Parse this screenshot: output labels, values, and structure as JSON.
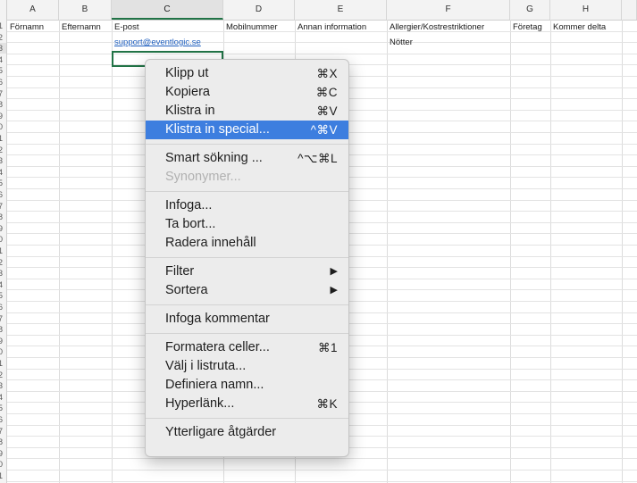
{
  "columns": [
    {
      "letter": "A",
      "header": "Förnamn"
    },
    {
      "letter": "B",
      "header": "Efternamn"
    },
    {
      "letter": "C",
      "header": "E-post"
    },
    {
      "letter": "D",
      "header": "Mobilnummer"
    },
    {
      "letter": "E",
      "header": "Annan information"
    },
    {
      "letter": "F",
      "header": "Allergier/Kostrestriktioner"
    },
    {
      "letter": "G",
      "header": "Företag"
    },
    {
      "letter": "H",
      "header": "Kommer delta"
    }
  ],
  "row_numbers": [
    "1",
    "2",
    "3",
    "4",
    "5",
    "6",
    "7",
    "8",
    "9",
    "0",
    "1",
    "2",
    "3",
    "4",
    "5",
    "6",
    "7",
    "8",
    "9",
    "0",
    "1",
    "2",
    "3",
    "4",
    "5",
    "6",
    "7",
    "8",
    "9",
    "0",
    "1",
    "2",
    "3",
    "4",
    "5",
    "6",
    "7",
    "8",
    "9",
    "0",
    "1"
  ],
  "row2": {
    "email": "support@eventlogic.se",
    "allergy": "Nötter"
  },
  "context_menu": {
    "group1": [
      {
        "label": "Klipp ut",
        "shortcut": "⌘X"
      },
      {
        "label": "Kopiera",
        "shortcut": "⌘C"
      },
      {
        "label": "Klistra in",
        "shortcut": "⌘V"
      },
      {
        "label": "Klistra in special...",
        "shortcut": "^⌘V",
        "highlighted": true
      }
    ],
    "group2": [
      {
        "label": "Smart sökning ...",
        "shortcut": "^⌥⌘L"
      },
      {
        "label": "Synonymer...",
        "shortcut": "",
        "disabled": true
      }
    ],
    "group3": [
      {
        "label": "Infoga...",
        "shortcut": ""
      },
      {
        "label": "Ta bort...",
        "shortcut": ""
      },
      {
        "label": "Radera innehåll",
        "shortcut": ""
      }
    ],
    "group4": [
      {
        "label": "Filter",
        "submenu": "▶"
      },
      {
        "label": "Sortera",
        "submenu": "▶"
      }
    ],
    "group5": [
      {
        "label": "Infoga kommentar"
      }
    ],
    "group6": [
      {
        "label": "Formatera celler...",
        "shortcut": "⌘1"
      },
      {
        "label": "Välj i listruta...",
        "shortcut": ""
      },
      {
        "label": "Definiera namn...",
        "shortcut": ""
      },
      {
        "label": "Hyperlänk...",
        "shortcut": "⌘K"
      }
    ],
    "group7": [
      {
        "label": "Ytterligare åtgärder"
      }
    ]
  },
  "colors": {
    "selection": "#217346",
    "highlight": "#3d7edf",
    "link": "#1f5fbf"
  }
}
